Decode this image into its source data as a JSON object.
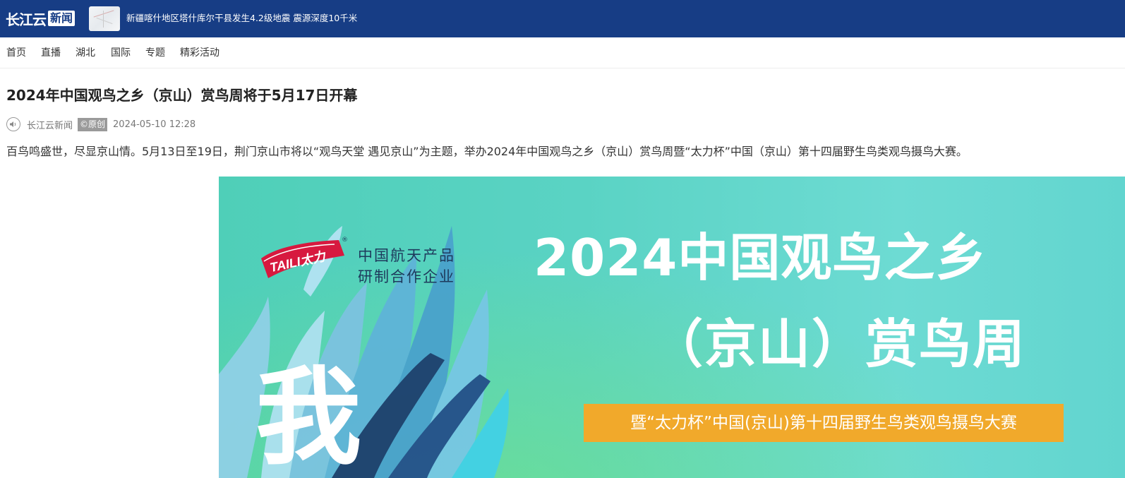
{
  "header": {
    "logo_main": "长江云",
    "logo_sub": "新闻",
    "headline": "新疆喀什地区塔什库尔干县发生4.2级地震 震源深度10千米"
  },
  "nav": {
    "items": [
      "首页",
      "直播",
      "湖北",
      "国际",
      "专题",
      "精彩活动"
    ]
  },
  "article": {
    "title": "2024年中国观鸟之乡（京山）赏鸟周将于5月17日开幕",
    "source": "长江云新闻",
    "badge": "©原创",
    "date": "2024-05-10 12:28",
    "summary": "百鸟鸣盛世，尽显京山情。5月13日至19日，荆门京山市将以“观鸟天堂 遇见京山”为主题，举办2024年中国观鸟之乡（京山）赏鸟周暨“太力杯”中国（京山）第十四届野生鸟类观鸟摄鸟大赛。"
  },
  "poster": {
    "brand": "TAILI太力",
    "sponsor_line1": "中国航天产品",
    "sponsor_line2": "研制合作企业",
    "heading_line1": "2024中国观鸟之乡",
    "heading_line2": "（京山）赏鸟周",
    "banner": "暨“太力杯”中国(京山)第十四届野生鸟类观鸟摄鸟大赛",
    "big_char": "我"
  },
  "colors": {
    "header_bg": "#173d85",
    "banner_orange": "#f1a92b",
    "poster_teal": "#4fcfb8"
  }
}
